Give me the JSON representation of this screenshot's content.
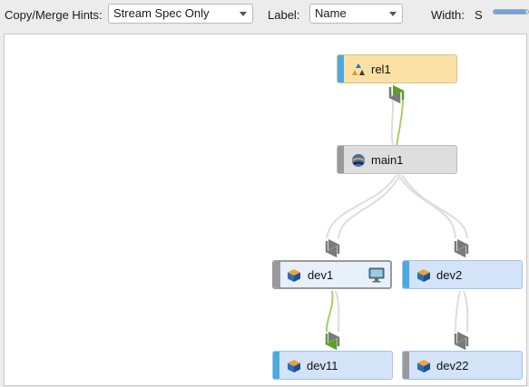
{
  "toolbar": {
    "copy_merge_label": "Copy/Merge Hints:",
    "copy_merge_value": "Stream Spec Only",
    "label_label": "Label:",
    "label_value": "Name",
    "width_label": "Width:",
    "width_value": "S",
    "width_slider_level": 0.95
  },
  "graph": {
    "nodes": [
      {
        "id": "rel1",
        "label": "rel1",
        "type": "release",
        "icon": "release-triangles-icon",
        "bar_color": "#4aa9e4"
      },
      {
        "id": "main1",
        "label": "main1",
        "type": "mainline",
        "icon": "mainline-globe-icon",
        "bar_color": "#9a9a9a"
      },
      {
        "id": "dev1",
        "label": "dev1",
        "type": "development",
        "icon": "development-cube-icon",
        "bar_color": "#9a9a9a",
        "selected": true,
        "workspace_icon": "monitor-icon"
      },
      {
        "id": "dev2",
        "label": "dev2",
        "type": "development",
        "icon": "development-cube-icon",
        "bar_color": "#4aa9e4"
      },
      {
        "id": "dev11",
        "label": "dev11",
        "type": "development",
        "icon": "development-cube-icon",
        "bar_color": "#4aa9e4"
      },
      {
        "id": "dev22",
        "label": "dev22",
        "type": "development",
        "icon": "development-cube-icon",
        "bar_color": "#9a9a9a"
      }
    ],
    "colors": {
      "release": "#fbe0a6",
      "mainline": "#dedede",
      "development": "#d3e3f8",
      "merge_ready": "#5aa028",
      "merge_not_needed": "#7a7a7a"
    }
  }
}
